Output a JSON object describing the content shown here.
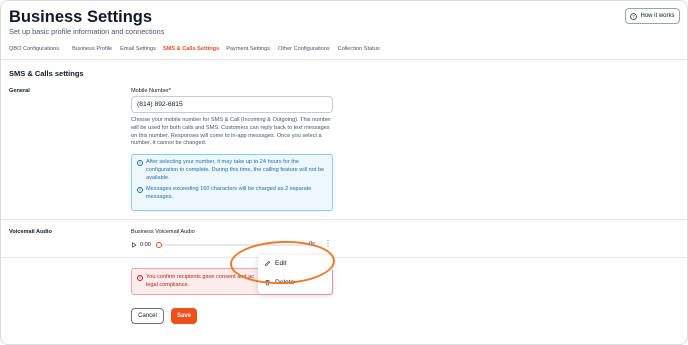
{
  "header": {
    "title": "Business Settings",
    "subtitle": "Set up basic profile information and connections",
    "how_it_works_label": "How it works"
  },
  "tabs": [
    {
      "label": "QBO Configurations",
      "active": false
    },
    {
      "label": "Business Profile",
      "active": false
    },
    {
      "label": "Email Settings",
      "active": false
    },
    {
      "label": "SMS & Calls Settings",
      "active": true
    },
    {
      "label": "Payment Settings",
      "active": false
    },
    {
      "label": "Other Configurations",
      "active": false
    },
    {
      "label": "Collection Status",
      "active": false
    }
  ],
  "section": {
    "title": "SMS & Calls settings"
  },
  "general": {
    "label": "General",
    "mobile_label": "Mobile Number*",
    "mobile_value": "(814) 892-6815",
    "help_text": "Choose your mobile number for SMS & Call (Incoming & Outgoing). This number will be used for both calls and SMS. Customers can reply back to text messages on this number. Responses will come to in-app messages. Once you select a number, it cannot be changed.",
    "info": [
      "After selecting your number, it may take up to 24 hours for the configuration to complete. During this time, the calling feature will not be available.",
      "Messages exceeding 160 characters will be charged as 2 separate messages."
    ]
  },
  "voicemail": {
    "label": "Voicemail Audio",
    "audio_label": "Business Voicemail Audio",
    "time": "0:00",
    "duration_suffix": "0s",
    "progress": 0,
    "menu": {
      "edit": "Edit",
      "delete": "Delete"
    }
  },
  "consent": {
    "line1": "You confirm recipients gave consent and ac",
    "line2": "legal compliance."
  },
  "footer": {
    "cancel": "Cancel",
    "save": "Save"
  },
  "colors": {
    "accent": "#f04e1a",
    "info": "#1d6fa8",
    "error": "#b42318",
    "highlight": "#ea7a2a"
  }
}
